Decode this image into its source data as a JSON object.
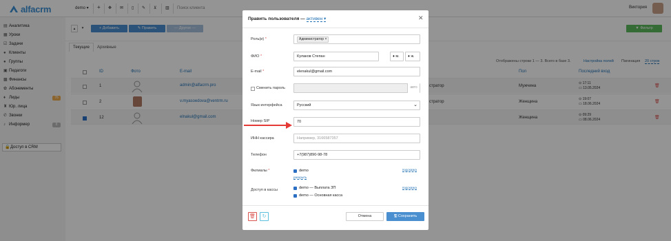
{
  "topbar": {
    "logo": "alfacrm",
    "branch": "demo ▾",
    "plus": "+",
    "search_placeholder": "Поиск клиента",
    "user_name": "Виктория",
    "icons": [
      "list-icon",
      "plus-icon",
      "move-icon",
      "mail-icon",
      "phone-icon",
      "pen-icon",
      "cart-icon",
      "chart-icon"
    ]
  },
  "sidebar": {
    "items": [
      {
        "label": "Аналитика",
        "icon": "analytics-icon"
      },
      {
        "label": "Уроки",
        "icon": "calendar-icon"
      },
      {
        "label": "Задачи",
        "icon": "tasks-icon"
      },
      {
        "label": "Клиенты",
        "icon": "clients-icon"
      },
      {
        "label": "Группы",
        "icon": "groups-icon"
      },
      {
        "label": "Педагоги",
        "icon": "teachers-icon"
      },
      {
        "label": "Финансы",
        "icon": "finance-icon"
      },
      {
        "label": "Абонементы",
        "icon": "subscription-icon"
      },
      {
        "label": "Лиды",
        "icon": "leads-icon",
        "badge": "76",
        "badge_color": "#f0ad4e"
      },
      {
        "label": "Юр. лица",
        "icon": "legal-icon"
      },
      {
        "label": "Звонки",
        "icon": "calls-icon"
      },
      {
        "label": "Информер",
        "icon": "informer-icon",
        "badge": "8",
        "badge_color": "#bbbbbb"
      },
      {
        "label": "Доступ в CRM",
        "icon": "lock-icon",
        "active": true
      }
    ]
  },
  "toolbar": {
    "add": "+ Добавить",
    "edit": "✎ Править",
    "other": "— Другое —",
    "filter": "▼ Фильтр"
  },
  "tabs": {
    "current": "Текущие",
    "archive": "Архивные"
  },
  "info": {
    "shown": "Отображены строки 1 — 3. Всего в базе 3.",
    "settings": "Настройка полей",
    "pagination": "Пагинация",
    "per_page": "20 строк"
  },
  "table": {
    "headers": [
      "ID",
      "Фото",
      "E-mail",
      "Пол",
      "Последний вход"
    ],
    "rows": [
      {
        "id": "1",
        "email": "admin@alfacrm.pro",
        "role": "стратор",
        "gender": "Мужчина",
        "time": "⊙ 17:11",
        "date": "▭ 13.05.2024",
        "checked": false,
        "photo": "placeholder"
      },
      {
        "id": "2",
        "email": "v.myasoedova@ventrm.ru",
        "role": "стратор",
        "gender": "Женщина",
        "time": "⊙ 19:07",
        "date": "▭ 18.06.2024",
        "checked": false,
        "photo": "woman"
      },
      {
        "id": "12",
        "email": "elnakul@gmail.com",
        "role": "",
        "gender": "Женщина",
        "time": "⊙ 09:29",
        "date": "▭ 08.06.2024",
        "checked": true,
        "photo": "placeholder"
      }
    ]
  },
  "modal": {
    "title": "Править пользователя —",
    "status": "активен ▾",
    "close": "✕",
    "labels": {
      "roles": "Роль(и)",
      "fio": "ФИО",
      "email": "E-mail",
      "change_password": "Сменить пароль",
      "language": "Язык интерфейса",
      "sip": "Номер SIP",
      "inn": "ИНН кассира",
      "phone": "Телефон",
      "branches": "Филиалы",
      "cash": "Доступ в кассы"
    },
    "role_tag": "Администратор ×",
    "fio_value": "Кулаков Степан",
    "gender_m": "♦ м.",
    "gender_f": "♦ ж.",
    "email_value": "elenakul@gmail.com",
    "auto": "авто",
    "language_value": "Русский",
    "sip_value": "70",
    "inn_placeholder": "Например, 3166587357",
    "phone_value": "+7(987)890-98-78",
    "branch": "demo",
    "hint": "подсказка",
    "expand": "раскрыть",
    "cash1": "demo — Выплата ЗП",
    "cash2": "demo — Основная касса",
    "cancel": "Отмена",
    "save": "🖫 Сохранить",
    "required_mark": "*"
  }
}
